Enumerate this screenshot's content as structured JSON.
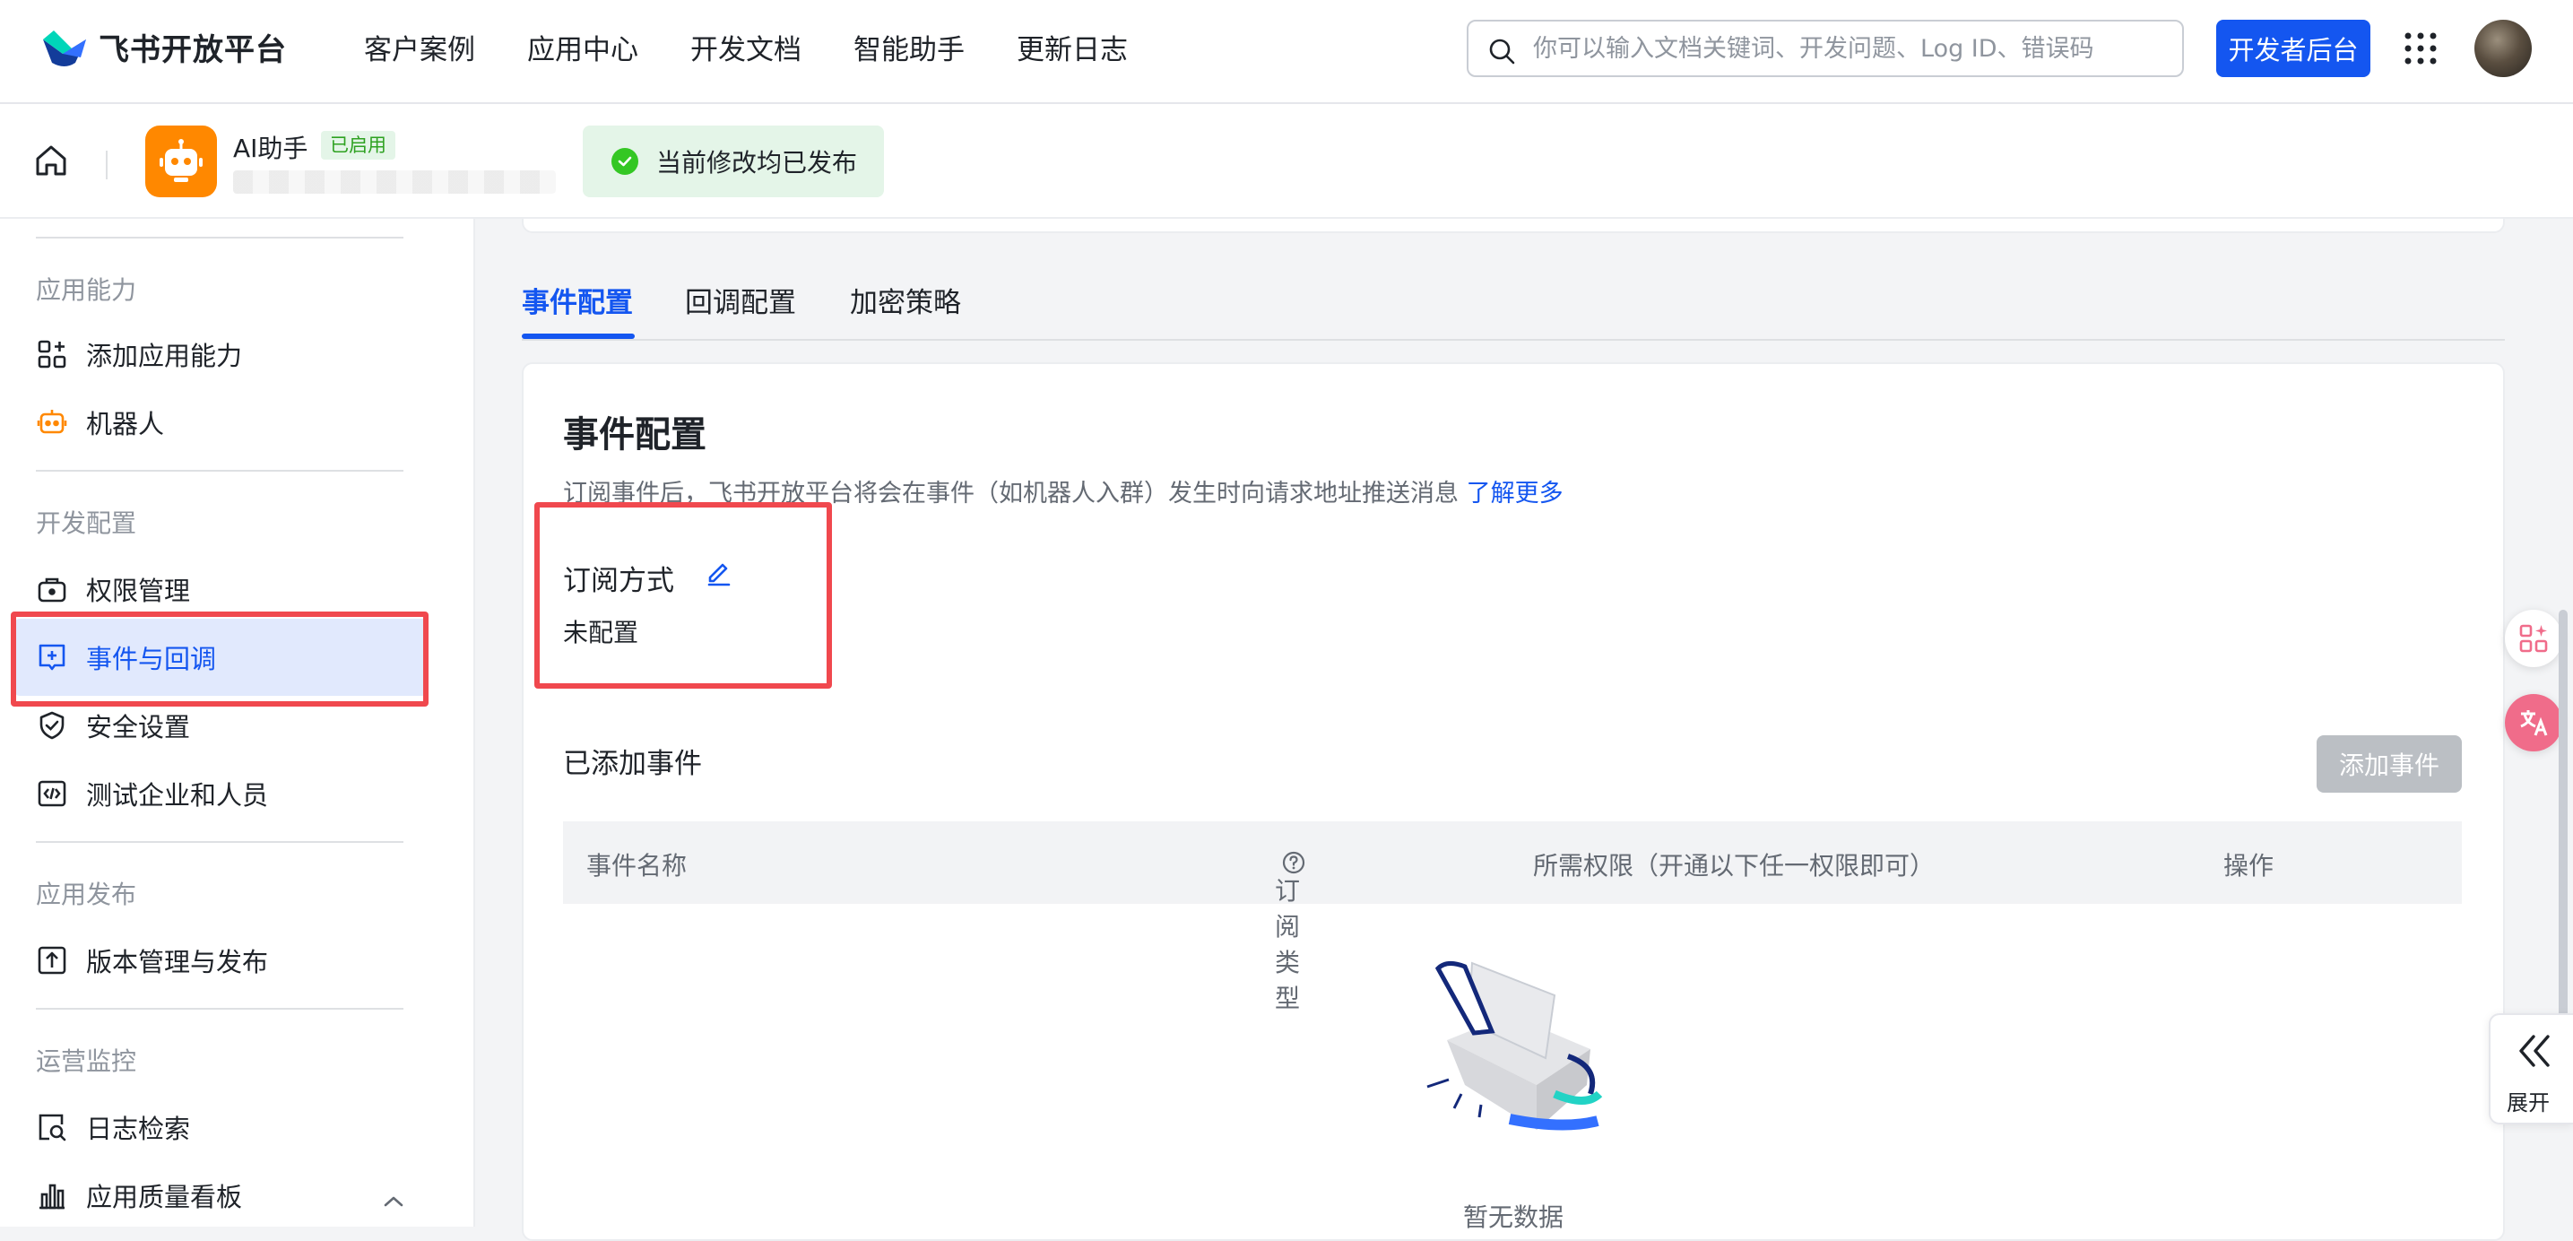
{
  "topnav": {
    "brand": "飞书开放平台",
    "links": [
      "客户案例",
      "应用中心",
      "开发文档",
      "智能助手",
      "更新日志"
    ],
    "search_placeholder": "你可以输入文档关键词、开发问题、Log ID、错误码",
    "dev_console": "开发者后台"
  },
  "appbar": {
    "app_name": "AI助手",
    "status_tag": "已启用",
    "published_notice": "当前修改均已发布"
  },
  "sidebar": {
    "groups": [
      {
        "title": "应用能力",
        "items": [
          {
            "label": "添加应用能力",
            "icon": "apps-add-icon"
          },
          {
            "label": "机器人",
            "icon": "robot-icon"
          }
        ]
      },
      {
        "title": "开发配置",
        "items": [
          {
            "label": "权限管理",
            "icon": "lock-bag-icon"
          },
          {
            "label": "事件与回调",
            "icon": "event-icon",
            "active": true
          },
          {
            "label": "安全设置",
            "icon": "shield-icon"
          },
          {
            "label": "测试企业和人员",
            "icon": "code-icon"
          }
        ]
      },
      {
        "title": "应用发布",
        "items": [
          {
            "label": "版本管理与发布",
            "icon": "upload-icon"
          }
        ]
      },
      {
        "title": "运营监控",
        "items": [
          {
            "label": "日志检索",
            "icon": "log-search-icon"
          },
          {
            "label": "应用质量看板",
            "icon": "bar-chart-icon"
          }
        ]
      }
    ]
  },
  "tabs": [
    "事件配置",
    "回调配置",
    "加密策略"
  ],
  "event_config": {
    "title": "事件配置",
    "description": "订阅事件后，飞书开放平台将会在事件（如机器人入群）发生时向请求地址推送消息",
    "learn_more": "了解更多",
    "subscription_label": "订阅方式",
    "subscription_value": "未配置",
    "added_events_title": "已添加事件",
    "add_event_button": "添加事件",
    "table_headers": [
      "事件名称",
      "订阅类型",
      "所需权限（开通以下任一权限即可）",
      "操作"
    ],
    "empty_text": "暂无数据"
  },
  "right_panel": {
    "expand_label": "展开"
  },
  "colors": {
    "primary": "#1456f0",
    "highlight_box": "#f0484e",
    "success": "#34c724",
    "app_icon": "#ff8800"
  }
}
